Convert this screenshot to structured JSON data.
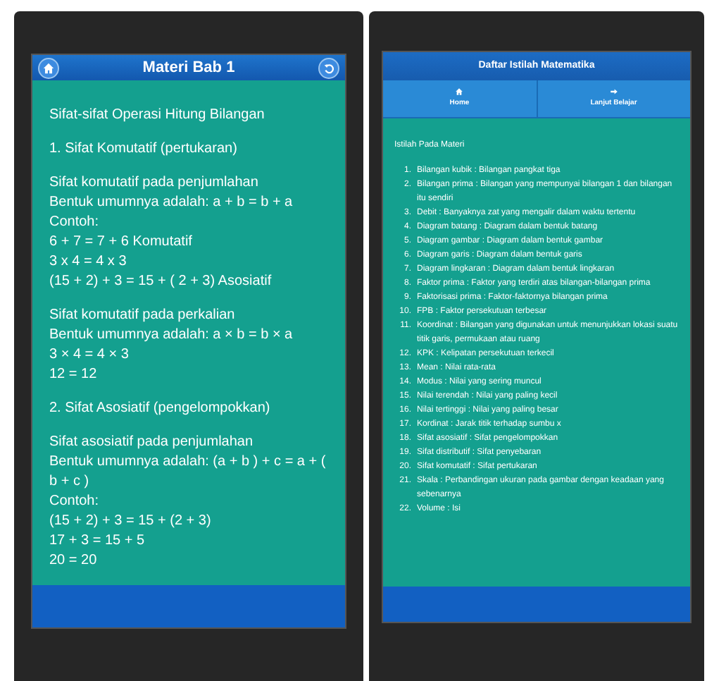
{
  "left_screen": {
    "header": {
      "title": "Materi Bab 1"
    },
    "paragraphs": [
      {
        "lines": [
          "Sifat-sifat Operasi Hitung Bilangan"
        ]
      },
      {
        "lines": [
          "1. Sifat Komutatif (pertukaran)"
        ]
      },
      {
        "lines": [
          "Sifat komutatif pada penjumlahan",
          "Bentuk umumnya adalah: a + b = b + a",
          "Contoh:",
          "6 + 7 = 7 + 6 Komutatif",
          "3 x 4 = 4 x 3",
          "(15 + 2) + 3 = 15 + ( 2 + 3) Asosiatif"
        ]
      },
      {
        "lines": [
          "Sifat komutatif pada perkalian",
          "Bentuk umumnya adalah: a × b = b × a",
          "3 × 4 = 4 × 3",
          "12 = 12"
        ]
      },
      {
        "lines": [
          "2. Sifat Asosiatif (pengelompokkan)"
        ]
      },
      {
        "lines": [
          "Sifat asosiatif pada penjumlahan",
          "Bentuk umumnya adalah: (a + b ) + c = a + ( b + c )",
          "Contoh:",
          "(15 + 2) + 3 = 15 + (2 + 3)",
          "17 + 3 = 15 + 5",
          "20 = 20"
        ]
      }
    ]
  },
  "right_screen": {
    "header": {
      "title": "Daftar Istilah Matematika"
    },
    "nav": [
      {
        "label": "Home",
        "kind": "home"
      },
      {
        "label": "Lanjut Belajar",
        "kind": "next"
      }
    ],
    "heading": "Istilah Pada Materi",
    "items": [
      {
        "number": "1.",
        "text": "Bilangan kubik : Bilangan pangkat tiga"
      },
      {
        "number": "2.",
        "text": "Bilangan prima : Bilangan yang mempunyai bilangan 1 dan bilangan itu sendiri"
      },
      {
        "number": "3.",
        "text": "Debit : Banyaknya zat yang mengalir dalam waktu tertentu"
      },
      {
        "number": "4.",
        "text": "Diagram batang : Diagram dalam bentuk batang"
      },
      {
        "number": "5.",
        "text": "Diagram gambar : Diagram dalam bentuk gambar"
      },
      {
        "number": "6.",
        "text": "Diagram garis : Diagram dalam bentuk garis"
      },
      {
        "number": "7.",
        "text": "Diagram lingkaran : Diagram dalam bentuk lingkaran"
      },
      {
        "number": "8.",
        "text": "Faktor prima : Faktor yang terdiri atas bilangan-bilangan prima"
      },
      {
        "number": "9.",
        "text": "Faktorisasi prima : Faktor-faktornya bilangan prima"
      },
      {
        "number": "10.",
        "text": "FPB : Faktor persekutuan terbesar"
      },
      {
        "number": "11.",
        "text": "Koordinat : Bilangan yang digunakan untuk menunjukkan lokasi suatu titik garis, permukaan atau ruang"
      },
      {
        "number": "12.",
        "text": "KPK : Kelipatan persekutuan terkecil"
      },
      {
        "number": "13.",
        "text": "Mean : Nilai rata-rata"
      },
      {
        "number": "14.",
        "text": "Modus : Nilai yang sering muncul"
      },
      {
        "number": "15.",
        "text": "Nilai terendah : Nilai yang paling kecil"
      },
      {
        "number": "16.",
        "text": "Nilai tertinggi : Nilai yang paling besar"
      },
      {
        "number": "17.",
        "text": "Kordinat : Jarak titik terhadap sumbu x"
      },
      {
        "number": "18.",
        "text": "Sifat asosiatif : Sifat pengelompokkan"
      },
      {
        "number": "19.",
        "text": "Sifat distributif : Sifat penyebaran"
      },
      {
        "number": "20.",
        "text": "Sifat komutatif : Sifat pertukaran"
      },
      {
        "number": "21.",
        "text": "Skala : Perbandingan ukuran pada gambar dengan keadaan yang sebenarnya"
      },
      {
        "number": "22.",
        "text": "Volume : Isi"
      }
    ]
  }
}
